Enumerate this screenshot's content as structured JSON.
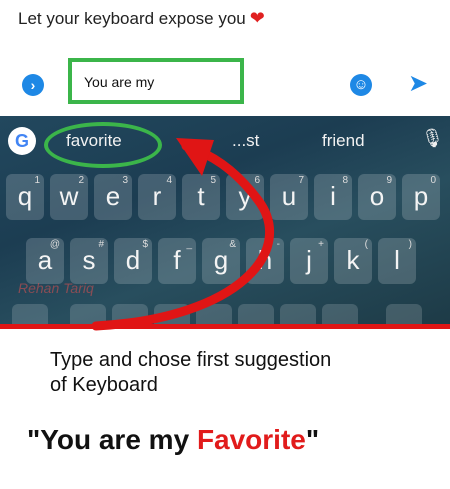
{
  "headline": {
    "text": "Let your keyboard expose you",
    "emoji": "heart-emoji"
  },
  "composer": {
    "message_text": "You are my",
    "icons": {
      "expand": "chevron-right-icon",
      "emoji": "smiley-icon",
      "send": "send-icon"
    }
  },
  "keyboard": {
    "suggestions": [
      "favorite",
      "...st",
      "friend"
    ],
    "icons": {
      "logo": "google-g-icon",
      "mic": "mic-icon"
    },
    "rows": [
      [
        "q",
        "w",
        "e",
        "r",
        "t",
        "y",
        "u",
        "i",
        "o",
        "p"
      ],
      [
        "a",
        "s",
        "d",
        "f",
        "g",
        "h",
        "j",
        "k",
        "l"
      ]
    ],
    "hints": [
      [
        "1",
        "2",
        "3",
        "4",
        "5",
        "6",
        "7",
        "8",
        "9",
        "0"
      ],
      [
        "@",
        "#",
        "$",
        "_",
        "&",
        "-",
        "+",
        "(",
        ")"
      ]
    ],
    "watermark": "Rehan Tariq"
  },
  "instruction": {
    "line1": "Type and chose first suggestion",
    "line2": "of Keyboard"
  },
  "result": {
    "prefix": "\"You are my ",
    "highlight": "Favorite",
    "suffix": "\""
  },
  "colors": {
    "highlight_green": "#3bb54a",
    "arrow_red": "#e01515",
    "accent_blue": "#1e88e5"
  }
}
